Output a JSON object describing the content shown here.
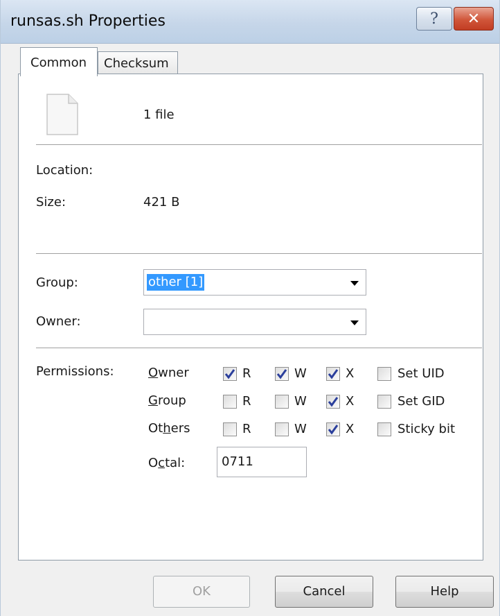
{
  "window": {
    "title": "runsas.sh Properties"
  },
  "titlebar": {
    "help_glyph": "?",
    "close_glyph": "✕"
  },
  "tabs": [
    {
      "label": "Common",
      "active": true
    },
    {
      "label": "Checksum",
      "active": false
    }
  ],
  "file": {
    "icon": "file-icon",
    "count_text": "1 file",
    "location_label": "Location:",
    "location_value": "",
    "size_label": "Size:",
    "size_value": "421 B"
  },
  "group": {
    "label": "Group:",
    "value": "other [1]",
    "options_visible": [
      "other [1]"
    ]
  },
  "owner": {
    "label": "Owner:",
    "value": ""
  },
  "permissions": {
    "label": "Permissions:",
    "rows": [
      {
        "name_pre": "",
        "name_u": "O",
        "name_post": "wner",
        "r": true,
        "w": true,
        "x": true,
        "special": "Set UID",
        "special_checked": false
      },
      {
        "name_pre": "",
        "name_u": "G",
        "name_post": "roup",
        "r": false,
        "w": false,
        "x": true,
        "special": "Set GID",
        "special_checked": false
      },
      {
        "name_pre": "Ot",
        "name_u": "h",
        "name_post": "ers",
        "r": false,
        "w": false,
        "x": true,
        "special": "Sticky bit",
        "special_checked": false
      }
    ],
    "r_label": "R",
    "w_label": "W",
    "x_label": "X",
    "octal_pre": "O",
    "octal_u": "c",
    "octal_post": "tal:",
    "octal_value": "0711"
  },
  "buttons": {
    "ok": "OK",
    "cancel": "Cancel",
    "help": "Help",
    "ok_enabled": false
  },
  "colors": {
    "selection": "#3399ff",
    "checkmark": "#2b3f9c",
    "close": "#c8452a"
  }
}
